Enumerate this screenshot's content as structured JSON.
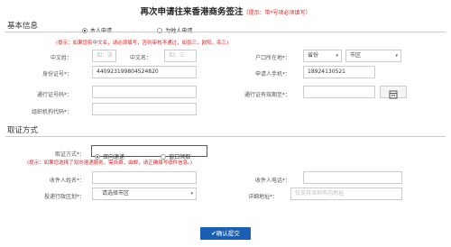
{
  "page": {
    "title": "再次申请往来香港商务签注",
    "title_hint": "（提示：带*号项必须填写）"
  },
  "basic": {
    "section_title": "基本信息",
    "radio_self": "本人申请",
    "radio_other": "为他人申请",
    "notice": "(提示：如果您有中文名，请必须填写，否则审核不通过，如张三，欧阳，名三)",
    "surname_label": "中文姓：",
    "surname_placeholder": "如：张",
    "givenname_label": "中文名：",
    "givenname_placeholder": "如：三",
    "hukou_label": "户口所在地*：",
    "province_value": "省份",
    "city_value": "市区",
    "idno_label": "身份证号*：",
    "idno_value": "440923199804524820",
    "phone_label": "申请人手机*：",
    "phone_value": "18924130521",
    "permit_label": "通行证号码*：",
    "permit_expiry_label": "通行证有效期至*：",
    "org_label": "组织机构代码*："
  },
  "pickup": {
    "section_title": "取证方式",
    "method_label": "取证方式*：",
    "opt_express": "双向速递",
    "opt_window": "窗口领取",
    "notice": "(提示：如果您选择了双向速递服务，需自费，由邮，请正确填写收件信息。)",
    "recipient_label": "收件人姓名*：",
    "recipient_phone_label": "收件人电话*：",
    "district_label": "投递行政区划*：",
    "district_value": "请选择市区",
    "address_label": "详细地址*：",
    "address_placeholder": "仅支持深圳市内地址"
  },
  "actions": {
    "submit_label": "✔确认提交"
  },
  "colors": {
    "required_red": "#e02020",
    "highlight_box": "#d92020",
    "submit_blue": "#1a5fb4"
  }
}
